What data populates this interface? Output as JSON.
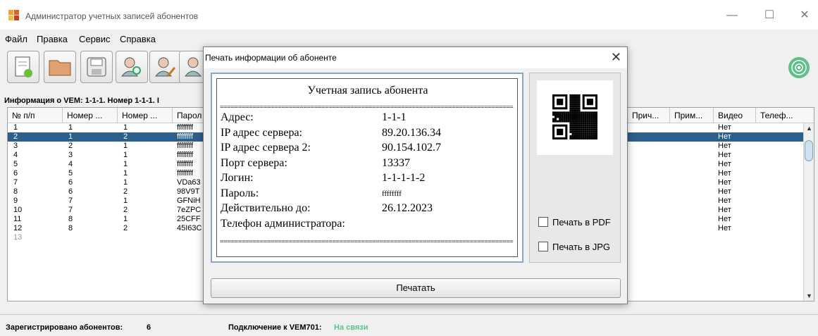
{
  "window": {
    "title": "Администратор учетных записей абонентов"
  },
  "menu": [
    "Файл",
    "Правка",
    "Сервис",
    "Справка"
  ],
  "info_bar": "Информация о VEM: 1-1-1. Номер 1-1-1. I",
  "table": {
    "columns": [
      "№ п/п",
      "Номер ...",
      "Номер ...",
      "Парол",
      "Прич...",
      "Прим...",
      "Видео",
      "Телеф..."
    ],
    "rows": [
      [
        "1",
        "1",
        "1",
        "ffffffff",
        "Нет"
      ],
      [
        "2",
        "1",
        "2",
        "ffffffff",
        "Нет"
      ],
      [
        "3",
        "2",
        "1",
        "ffffffff",
        "Нет"
      ],
      [
        "4",
        "3",
        "1",
        "ffffffff",
        "Нет"
      ],
      [
        "5",
        "4",
        "1",
        "ffffffff",
        "Нет"
      ],
      [
        "6",
        "5",
        "1",
        "ffffffff",
        "Нет"
      ],
      [
        "7",
        "6",
        "1",
        "VDa63",
        "Нет"
      ],
      [
        "8",
        "6",
        "2",
        "98V9T",
        "Нет"
      ],
      [
        "9",
        "7",
        "1",
        "GFNiH",
        "Нет"
      ],
      [
        "10",
        "7",
        "2",
        "7eZPC",
        "Нет"
      ],
      [
        "11",
        "8",
        "1",
        "25CFF",
        "Нет"
      ],
      [
        "12",
        "8",
        "2",
        "45I63C",
        "Нет"
      ],
      [
        "13",
        "",
        "",
        "",
        ""
      ]
    ]
  },
  "dialog": {
    "title": "Печать информации об абоненте",
    "heading": "Учетная запись абонента",
    "separator": "=================================================================================",
    "fields": [
      {
        "label": "Адрес:",
        "value": "1-1-1"
      },
      {
        "label": "IP адрес сервера:",
        "value": "89.20.136.34"
      },
      {
        "label": "IP адрес сервера 2:",
        "value": "90.154.102.7"
      },
      {
        "label": "Порт сервера:",
        "value": "13337"
      },
      {
        "label": "Логин:",
        "value": "1-1-1-1-2"
      },
      {
        "label": "Пароль:",
        "value": "ffffffff"
      },
      {
        "label": "Действительно до:",
        "value": "26.12.2023"
      },
      {
        "label": "Телефон администратора:",
        "value": ""
      }
    ],
    "print_pdf": "Печать в PDF",
    "print_jpg": "Печать в JPG",
    "print_button": "Печатать"
  },
  "status": {
    "registered_label": "Зарегистрировано абонентов:",
    "registered_count": "6",
    "connection_label": "Подключение к VEM701:",
    "connection_value": "На связи",
    "connection_color": "#5fc28a"
  },
  "icons": [
    "app-icon",
    "new-document-icon",
    "folder-icon",
    "save-icon",
    "search-user-icon",
    "edit-user-icon",
    "add-user-icon",
    "signal-icon",
    "close-icon",
    "minimize-icon",
    "maximize-icon",
    "qr-code-icon"
  ]
}
